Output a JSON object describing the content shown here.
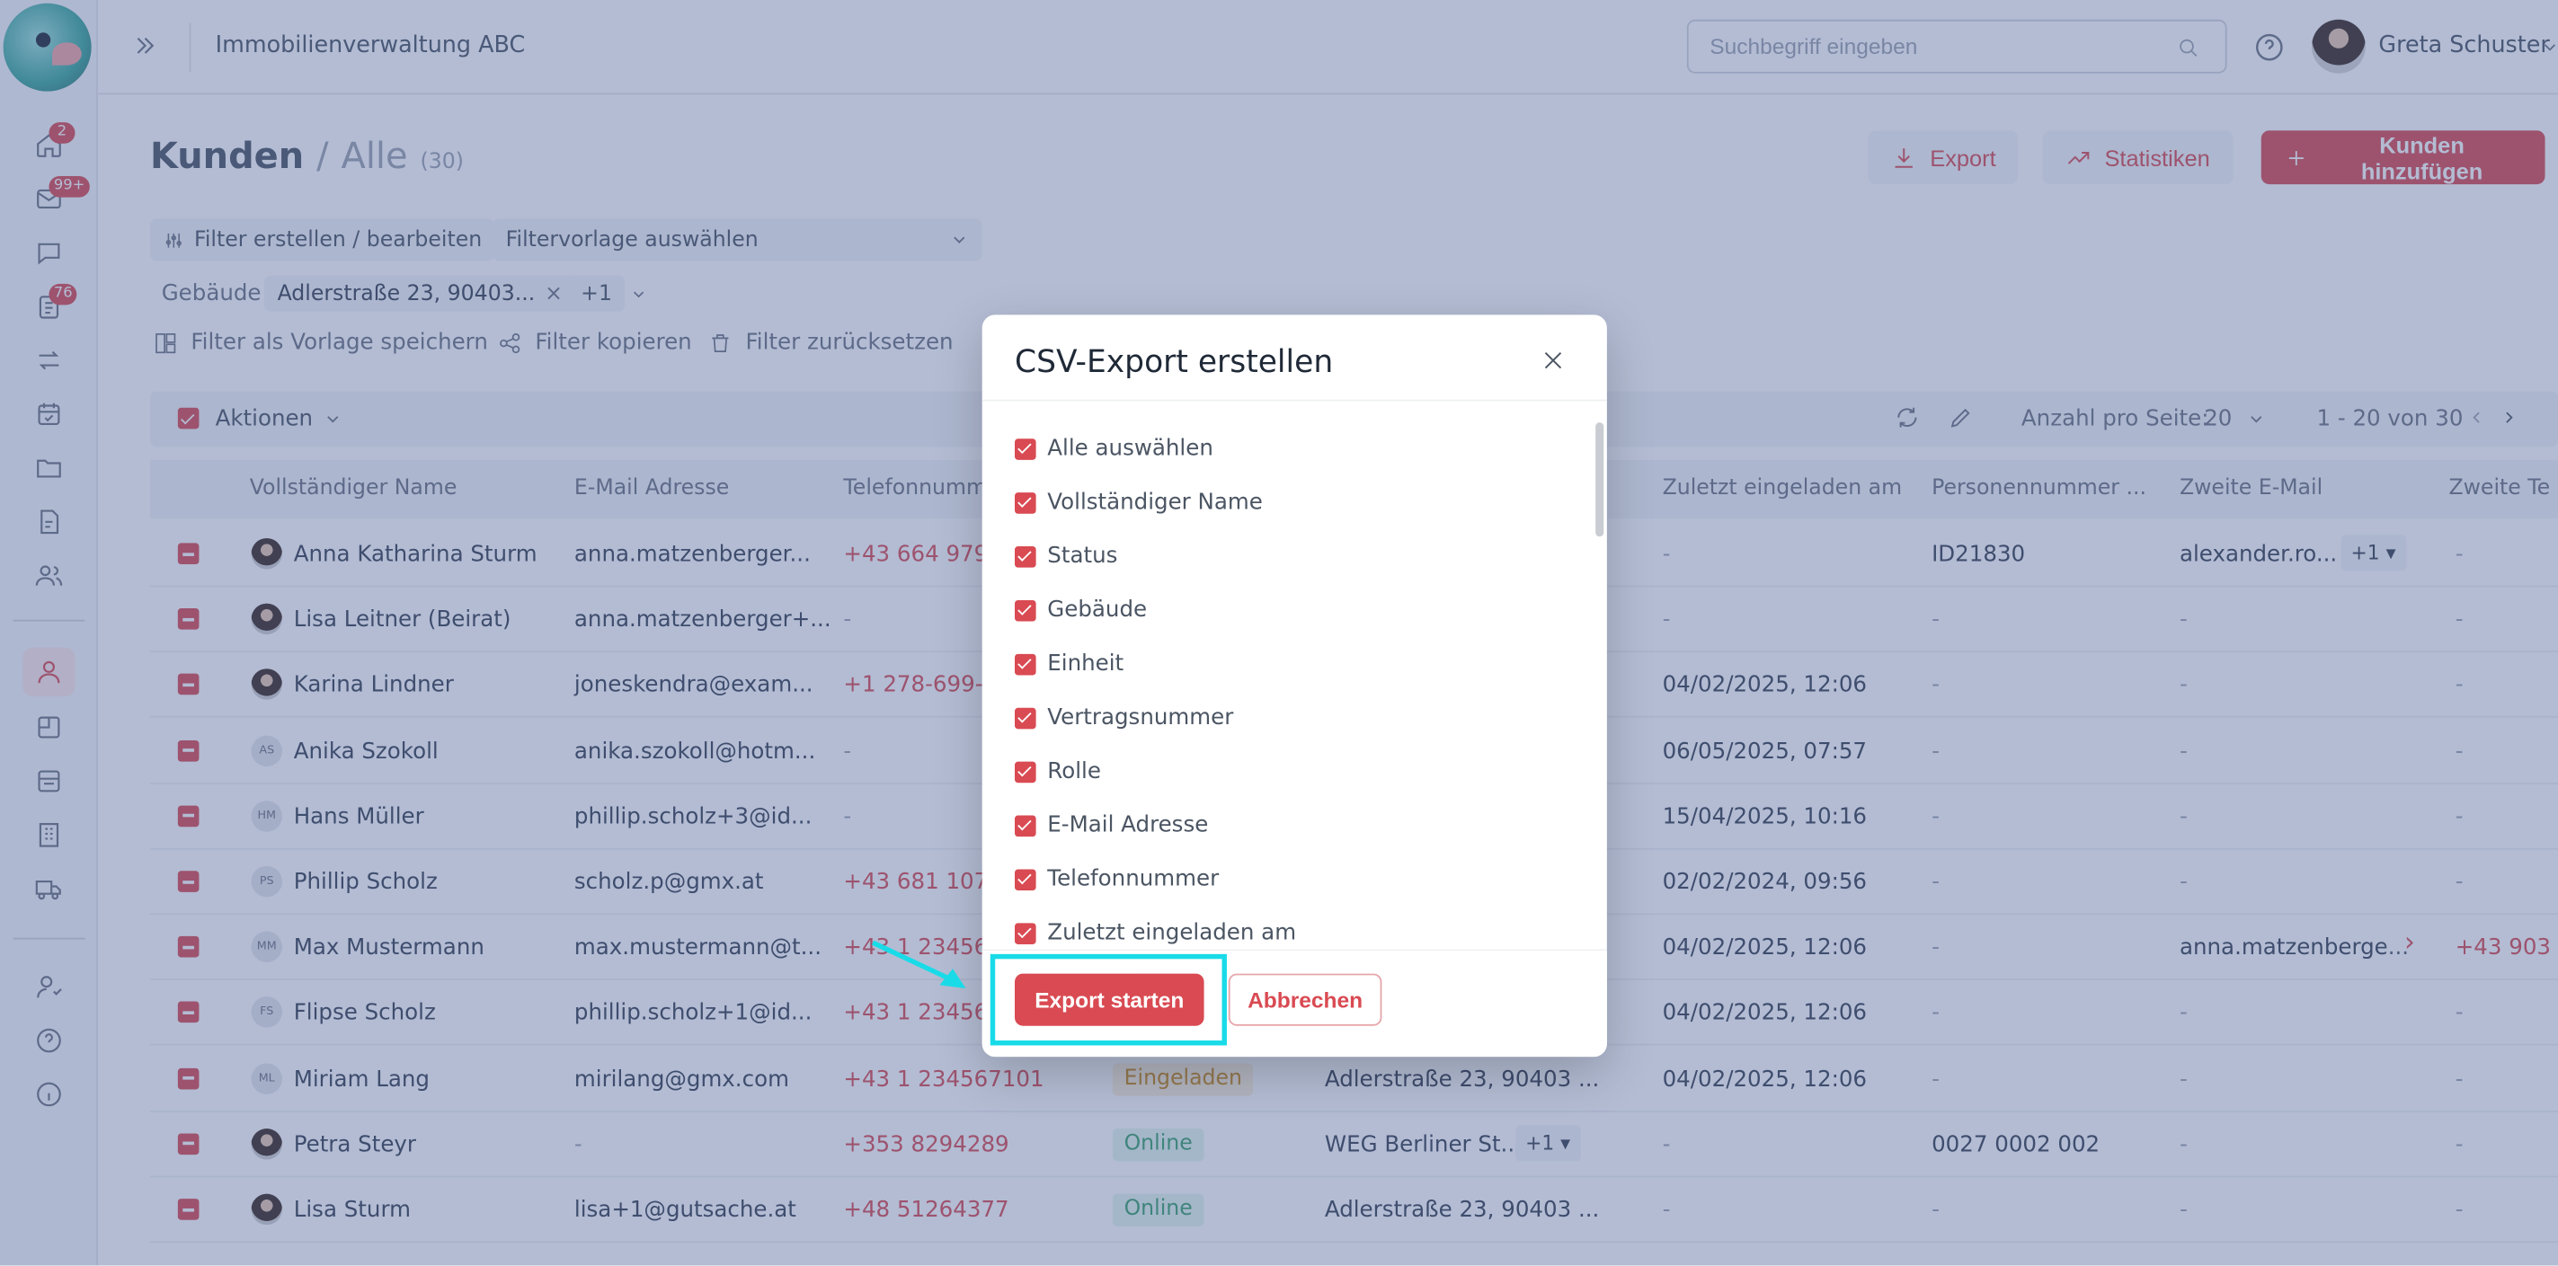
{
  "header": {
    "company": "Immobilienverwaltung ABC",
    "search_placeholder": "Suchbegriff eingeben",
    "user_name": "Greta Schuster"
  },
  "sidebar": {
    "badges": {
      "home": "2",
      "inbox": "99+",
      "tasks": "76"
    }
  },
  "page": {
    "title": "Kunden",
    "separator": "/",
    "subtitle": "Alle",
    "count": "(30)",
    "export_label": "Export",
    "stats_label": "Statistiken",
    "add_label": "Kunden hinzufügen"
  },
  "filters": {
    "edit_label": "Filter erstellen / bearbeiten",
    "template_placeholder": "Filtervorlage auswählen",
    "building_label": "Gebäude",
    "building_value": "Adlerstraße 23, 90403...",
    "building_more": "+1",
    "save_template": "Filter als Vorlage speichern",
    "copy_filter": "Filter kopieren",
    "reset_filter": "Filter zurücksetzen"
  },
  "toolbar": {
    "actions_label": "Aktionen",
    "per_page_label": "Anzahl pro Seite:",
    "per_page_value": "20",
    "range": "1 - 20 von 30"
  },
  "table": {
    "columns": [
      "Vollständiger Name",
      "E-Mail Adresse",
      "Telefonnumm",
      "Zuletzt eingeladen am",
      "Personennummer ...",
      "Zweite E-Mail",
      "Zweite Te"
    ],
    "rows": [
      {
        "initials": "",
        "name": "Anna Katharina Sturm",
        "email": "anna.matzenberger...",
        "phone": "+43 664 9798",
        "status": "",
        "building": "",
        "invited": "-",
        "person_no": "ID21830",
        "second_email": "alexander.ro...",
        "second_more": "+1 ▾",
        "second_phone": "-"
      },
      {
        "initials": "",
        "name": "Lisa Leitner (Beirat)",
        "email": "anna.matzenberger+...",
        "phone": "-",
        "status": "",
        "building": "",
        "invited": "-",
        "person_no": "-",
        "second_email": "-",
        "second_more": "",
        "second_phone": "-"
      },
      {
        "initials": "",
        "name": "Karina Lindner",
        "email": "joneskendra@exam...",
        "phone": "+1 278-699-8",
        "status": "",
        "building": "",
        "invited": "04/02/2025, 12:06",
        "person_no": "-",
        "second_email": "-",
        "second_more": "",
        "second_phone": "-"
      },
      {
        "initials": "AS",
        "name": "Anika Szokoll",
        "email": "anika.szokoll@hotm...",
        "phone": "-",
        "status": "",
        "building": "",
        "invited": "06/05/2025, 07:57",
        "person_no": "-",
        "second_email": "-",
        "second_more": "",
        "second_phone": "-"
      },
      {
        "initials": "HM",
        "name": "Hans Müller",
        "email": "phillip.scholz+3@id...",
        "phone": "-",
        "status": "",
        "building": "",
        "invited": "15/04/2025, 10:16",
        "person_no": "-",
        "second_email": "-",
        "second_more": "",
        "second_phone": "-"
      },
      {
        "initials": "PS",
        "name": "Phillip Scholz",
        "email": "scholz.p@gmx.at",
        "phone": "+43 681 1077",
        "status": "",
        "building": "",
        "invited": "02/02/2024, 09:56",
        "person_no": "-",
        "second_email": "-",
        "second_more": "",
        "second_phone": "-"
      },
      {
        "initials": "MM",
        "name": "Max Mustermann",
        "email": "max.mustermann@t...",
        "phone": "+43 1 234567",
        "status": "",
        "building": "",
        "invited": "04/02/2025, 12:06",
        "person_no": "-",
        "second_email": "anna.matzenberge...",
        "second_more": "",
        "second_phone": "+43 903"
      },
      {
        "initials": "FS",
        "name": "Flipse Scholz",
        "email": "phillip.scholz+1@id...",
        "phone": "+43 1 234567",
        "status": "",
        "building": "",
        "invited": "04/02/2025, 12:06",
        "person_no": "-",
        "second_email": "-",
        "second_more": "",
        "second_phone": "-"
      },
      {
        "initials": "ML",
        "name": "Miriam Lang",
        "email": "mirilang@gmx.com",
        "phone": "+43 1 234567101",
        "status": "Eingeladen",
        "building": "Adlerstraße 23, 90403 ...",
        "building_more": "",
        "invited": "04/02/2025, 12:06",
        "person_no": "-",
        "second_email": "-",
        "second_more": "",
        "second_phone": "-"
      },
      {
        "initials": "",
        "name": "Petra Steyr",
        "email": "-",
        "phone": "+353 8294289",
        "status": "Online",
        "building": "WEG Berliner St...",
        "building_more": "+1 ▾",
        "invited": "-",
        "person_no": "0027 0002 002",
        "second_email": "-",
        "second_more": "",
        "second_phone": "-"
      },
      {
        "initials": "",
        "name": "Lisa Sturm",
        "email": "lisa+1@gutsache.at",
        "phone": "+48 51264377",
        "status": "Online",
        "building": "Adlerstraße 23, 90403 ...",
        "building_more": "",
        "invited": "-",
        "person_no": "-",
        "second_email": "-",
        "second_more": "",
        "second_phone": "-"
      }
    ]
  },
  "modal": {
    "title": "CSV-Export erstellen",
    "options": [
      "Alle auswählen",
      "Vollständiger Name",
      "Status",
      "Gebäude",
      "Einheit",
      "Vertragsnummer",
      "Rolle",
      "E-Mail Adresse",
      "Telefonnummer",
      "Zuletzt eingeladen am"
    ],
    "export_label": "Export starten",
    "cancel_label": "Abbrechen"
  },
  "colors": {
    "accent": "#d94a52",
    "highlight": "#19dbe8",
    "overlay": "#4a5f96"
  }
}
